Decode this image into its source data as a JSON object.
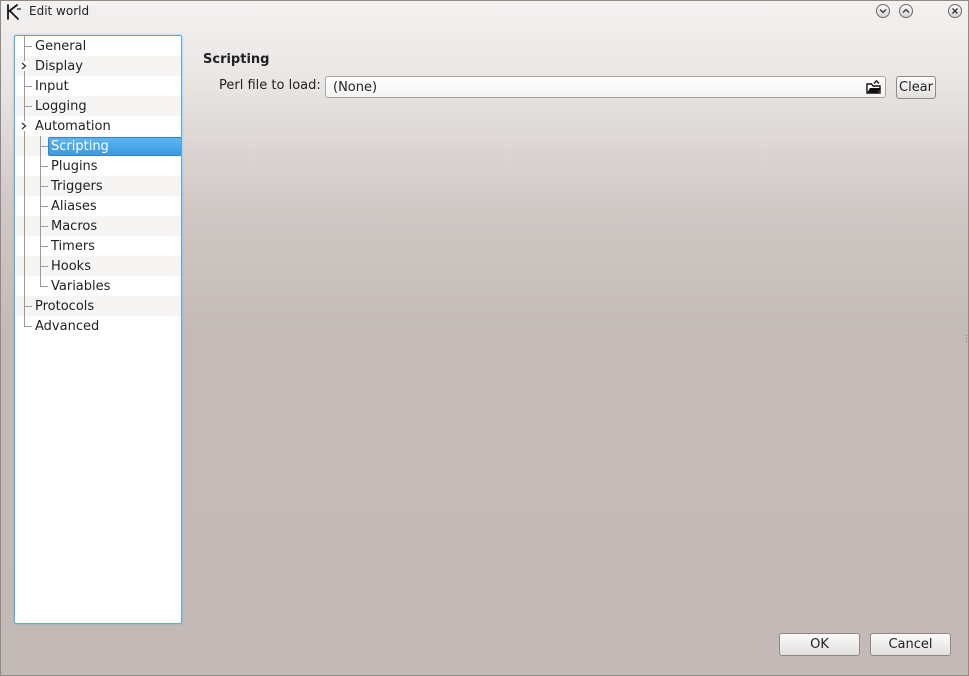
{
  "window": {
    "title": "Edit world",
    "buttons": [
      "minimize",
      "maximize",
      "close"
    ]
  },
  "tree": {
    "items": [
      {
        "label": "General",
        "level": 0,
        "expandable": false,
        "selected": false
      },
      {
        "label": "Display",
        "level": 0,
        "expandable": true,
        "selected": false
      },
      {
        "label": "Input",
        "level": 0,
        "expandable": false,
        "selected": false
      },
      {
        "label": "Logging",
        "level": 0,
        "expandable": false,
        "selected": false
      },
      {
        "label": "Automation",
        "level": 0,
        "expandable": true,
        "expanded": true,
        "selected": false
      },
      {
        "label": "Scripting",
        "level": 1,
        "expandable": false,
        "selected": true
      },
      {
        "label": "Plugins",
        "level": 1,
        "expandable": false,
        "selected": false
      },
      {
        "label": "Triggers",
        "level": 1,
        "expandable": false,
        "selected": false
      },
      {
        "label": "Aliases",
        "level": 1,
        "expandable": false,
        "selected": false
      },
      {
        "label": "Macros",
        "level": 1,
        "expandable": false,
        "selected": false
      },
      {
        "label": "Timers",
        "level": 1,
        "expandable": false,
        "selected": false
      },
      {
        "label": "Hooks",
        "level": 1,
        "expandable": false,
        "selected": false
      },
      {
        "label": "Variables",
        "level": 1,
        "expandable": false,
        "selected": false
      },
      {
        "label": "Protocols",
        "level": 0,
        "expandable": false,
        "selected": false
      },
      {
        "label": "Advanced",
        "level": 0,
        "expandable": false,
        "selected": false
      }
    ]
  },
  "main": {
    "section_title": "Scripting",
    "perl_file": {
      "label": "Perl file to load:",
      "value": "(None)",
      "browse_icon": "folder-open-icon",
      "clear_label": "Clear"
    }
  },
  "footer": {
    "ok_label": "OK",
    "cancel_label": "Cancel"
  },
  "colors": {
    "selection": "#3a9be0",
    "focus_border": "#5aa9e6"
  }
}
